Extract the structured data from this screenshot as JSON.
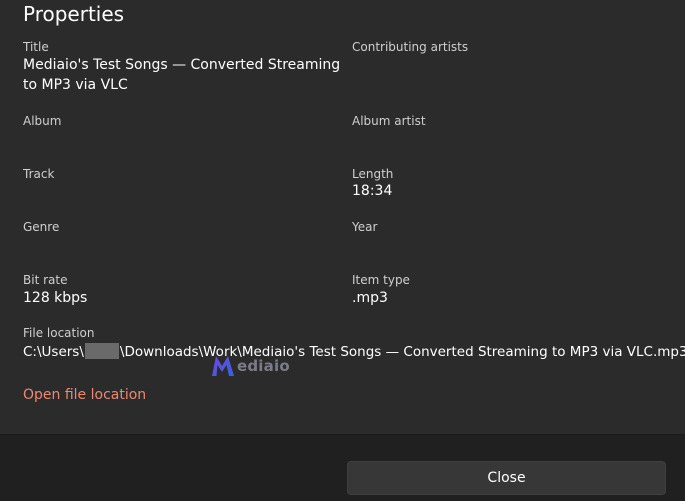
{
  "dialog": {
    "title": "Properties",
    "fields": {
      "title_label": "Title",
      "title_value": "Mediaio's Test Songs — Converted Streaming to MP3 via VLC",
      "contributing_artists_label": "Contributing artists",
      "album_label": "Album",
      "album_artist_label": "Album artist",
      "track_label": "Track",
      "length_label": "Length",
      "length_value": "18:34",
      "genre_label": "Genre",
      "year_label": "Year",
      "bit_rate_label": "Bit rate",
      "bit_rate_value": "128 kbps",
      "item_type_label": "Item type",
      "item_type_value": ".mp3",
      "file_location_label": "File location",
      "file_location_prefix": "C:\\Users\\",
      "file_location_suffix": "\\Downloads\\Work\\Mediaio's Test Songs — Converted Streaming to MP3 via VLC.mp3"
    },
    "open_file_location_link": "Open file location",
    "close_button": "Close"
  },
  "watermark": {
    "text": "ediaio",
    "logo_letter": "M"
  },
  "colors": {
    "background": "#2b2b2b",
    "footer": "#202020",
    "link": "#f1876f",
    "label": "#cfcfcf"
  }
}
